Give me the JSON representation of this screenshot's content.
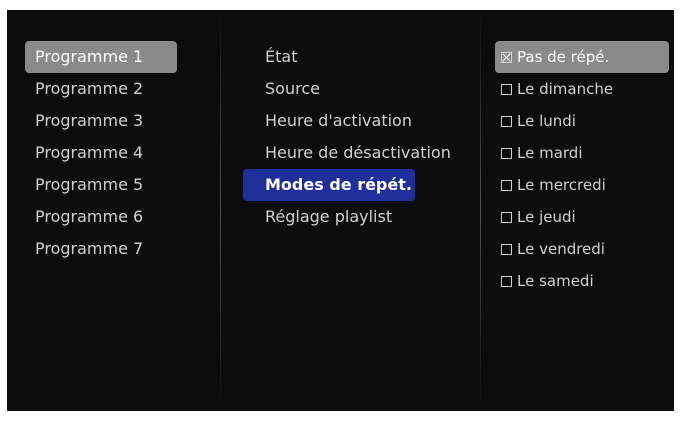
{
  "programs": [
    {
      "label": "Programme 1"
    },
    {
      "label": "Programme 2"
    },
    {
      "label": "Programme 3"
    },
    {
      "label": "Programme 4"
    },
    {
      "label": "Programme 5"
    },
    {
      "label": "Programme 6"
    },
    {
      "label": "Programme 7"
    }
  ],
  "settings": [
    {
      "label": "État"
    },
    {
      "label": "Source"
    },
    {
      "label": "Heure d'activation"
    },
    {
      "label": "Heure de désactivation"
    },
    {
      "label": "Modes de répét."
    },
    {
      "label": "Réglage playlist"
    }
  ],
  "repeat_options": [
    {
      "label": "Pas de répé.",
      "checked": true
    },
    {
      "label": "Le dimanche",
      "checked": false
    },
    {
      "label": "Le lundi",
      "checked": false
    },
    {
      "label": "Le mardi",
      "checked": false
    },
    {
      "label": "Le mercredi",
      "checked": false
    },
    {
      "label": "Le jeudi",
      "checked": false
    },
    {
      "label": "Le vendredi",
      "checked": false
    },
    {
      "label": "Le samedi",
      "checked": false
    }
  ],
  "colors": {
    "background": "#0c0c0c",
    "selected_grey": "#8a8a8a",
    "selected_blue": "#1f2f9a",
    "text": "#d0d0d0"
  }
}
